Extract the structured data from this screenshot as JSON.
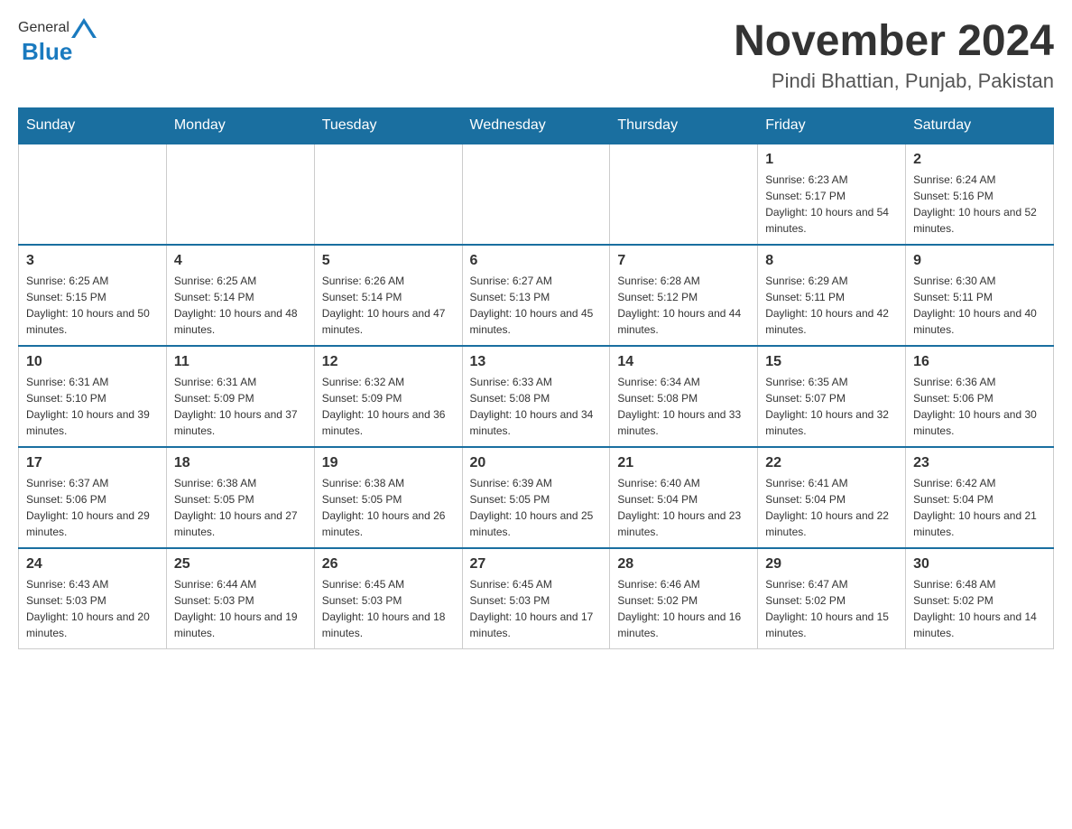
{
  "header": {
    "logo_general": "General",
    "logo_blue": "Blue",
    "title": "November 2024",
    "subtitle": "Pindi Bhattian, Punjab, Pakistan"
  },
  "calendar": {
    "days_of_week": [
      "Sunday",
      "Monday",
      "Tuesday",
      "Wednesday",
      "Thursday",
      "Friday",
      "Saturday"
    ],
    "weeks": [
      [
        {
          "day": "",
          "sunrise": "",
          "sunset": "",
          "daylight": ""
        },
        {
          "day": "",
          "sunrise": "",
          "sunset": "",
          "daylight": ""
        },
        {
          "day": "",
          "sunrise": "",
          "sunset": "",
          "daylight": ""
        },
        {
          "day": "",
          "sunrise": "",
          "sunset": "",
          "daylight": ""
        },
        {
          "day": "",
          "sunrise": "",
          "sunset": "",
          "daylight": ""
        },
        {
          "day": "1",
          "sunrise": "Sunrise: 6:23 AM",
          "sunset": "Sunset: 5:17 PM",
          "daylight": "Daylight: 10 hours and 54 minutes."
        },
        {
          "day": "2",
          "sunrise": "Sunrise: 6:24 AM",
          "sunset": "Sunset: 5:16 PM",
          "daylight": "Daylight: 10 hours and 52 minutes."
        }
      ],
      [
        {
          "day": "3",
          "sunrise": "Sunrise: 6:25 AM",
          "sunset": "Sunset: 5:15 PM",
          "daylight": "Daylight: 10 hours and 50 minutes."
        },
        {
          "day": "4",
          "sunrise": "Sunrise: 6:25 AM",
          "sunset": "Sunset: 5:14 PM",
          "daylight": "Daylight: 10 hours and 48 minutes."
        },
        {
          "day": "5",
          "sunrise": "Sunrise: 6:26 AM",
          "sunset": "Sunset: 5:14 PM",
          "daylight": "Daylight: 10 hours and 47 minutes."
        },
        {
          "day": "6",
          "sunrise": "Sunrise: 6:27 AM",
          "sunset": "Sunset: 5:13 PM",
          "daylight": "Daylight: 10 hours and 45 minutes."
        },
        {
          "day": "7",
          "sunrise": "Sunrise: 6:28 AM",
          "sunset": "Sunset: 5:12 PM",
          "daylight": "Daylight: 10 hours and 44 minutes."
        },
        {
          "day": "8",
          "sunrise": "Sunrise: 6:29 AM",
          "sunset": "Sunset: 5:11 PM",
          "daylight": "Daylight: 10 hours and 42 minutes."
        },
        {
          "day": "9",
          "sunrise": "Sunrise: 6:30 AM",
          "sunset": "Sunset: 5:11 PM",
          "daylight": "Daylight: 10 hours and 40 minutes."
        }
      ],
      [
        {
          "day": "10",
          "sunrise": "Sunrise: 6:31 AM",
          "sunset": "Sunset: 5:10 PM",
          "daylight": "Daylight: 10 hours and 39 minutes."
        },
        {
          "day": "11",
          "sunrise": "Sunrise: 6:31 AM",
          "sunset": "Sunset: 5:09 PM",
          "daylight": "Daylight: 10 hours and 37 minutes."
        },
        {
          "day": "12",
          "sunrise": "Sunrise: 6:32 AM",
          "sunset": "Sunset: 5:09 PM",
          "daylight": "Daylight: 10 hours and 36 minutes."
        },
        {
          "day": "13",
          "sunrise": "Sunrise: 6:33 AM",
          "sunset": "Sunset: 5:08 PM",
          "daylight": "Daylight: 10 hours and 34 minutes."
        },
        {
          "day": "14",
          "sunrise": "Sunrise: 6:34 AM",
          "sunset": "Sunset: 5:08 PM",
          "daylight": "Daylight: 10 hours and 33 minutes."
        },
        {
          "day": "15",
          "sunrise": "Sunrise: 6:35 AM",
          "sunset": "Sunset: 5:07 PM",
          "daylight": "Daylight: 10 hours and 32 minutes."
        },
        {
          "day": "16",
          "sunrise": "Sunrise: 6:36 AM",
          "sunset": "Sunset: 5:06 PM",
          "daylight": "Daylight: 10 hours and 30 minutes."
        }
      ],
      [
        {
          "day": "17",
          "sunrise": "Sunrise: 6:37 AM",
          "sunset": "Sunset: 5:06 PM",
          "daylight": "Daylight: 10 hours and 29 minutes."
        },
        {
          "day": "18",
          "sunrise": "Sunrise: 6:38 AM",
          "sunset": "Sunset: 5:05 PM",
          "daylight": "Daylight: 10 hours and 27 minutes."
        },
        {
          "day": "19",
          "sunrise": "Sunrise: 6:38 AM",
          "sunset": "Sunset: 5:05 PM",
          "daylight": "Daylight: 10 hours and 26 minutes."
        },
        {
          "day": "20",
          "sunrise": "Sunrise: 6:39 AM",
          "sunset": "Sunset: 5:05 PM",
          "daylight": "Daylight: 10 hours and 25 minutes."
        },
        {
          "day": "21",
          "sunrise": "Sunrise: 6:40 AM",
          "sunset": "Sunset: 5:04 PM",
          "daylight": "Daylight: 10 hours and 23 minutes."
        },
        {
          "day": "22",
          "sunrise": "Sunrise: 6:41 AM",
          "sunset": "Sunset: 5:04 PM",
          "daylight": "Daylight: 10 hours and 22 minutes."
        },
        {
          "day": "23",
          "sunrise": "Sunrise: 6:42 AM",
          "sunset": "Sunset: 5:04 PM",
          "daylight": "Daylight: 10 hours and 21 minutes."
        }
      ],
      [
        {
          "day": "24",
          "sunrise": "Sunrise: 6:43 AM",
          "sunset": "Sunset: 5:03 PM",
          "daylight": "Daylight: 10 hours and 20 minutes."
        },
        {
          "day": "25",
          "sunrise": "Sunrise: 6:44 AM",
          "sunset": "Sunset: 5:03 PM",
          "daylight": "Daylight: 10 hours and 19 minutes."
        },
        {
          "day": "26",
          "sunrise": "Sunrise: 6:45 AM",
          "sunset": "Sunset: 5:03 PM",
          "daylight": "Daylight: 10 hours and 18 minutes."
        },
        {
          "day": "27",
          "sunrise": "Sunrise: 6:45 AM",
          "sunset": "Sunset: 5:03 PM",
          "daylight": "Daylight: 10 hours and 17 minutes."
        },
        {
          "day": "28",
          "sunrise": "Sunrise: 6:46 AM",
          "sunset": "Sunset: 5:02 PM",
          "daylight": "Daylight: 10 hours and 16 minutes."
        },
        {
          "day": "29",
          "sunrise": "Sunrise: 6:47 AM",
          "sunset": "Sunset: 5:02 PM",
          "daylight": "Daylight: 10 hours and 15 minutes."
        },
        {
          "day": "30",
          "sunrise": "Sunrise: 6:48 AM",
          "sunset": "Sunset: 5:02 PM",
          "daylight": "Daylight: 10 hours and 14 minutes."
        }
      ]
    ]
  }
}
